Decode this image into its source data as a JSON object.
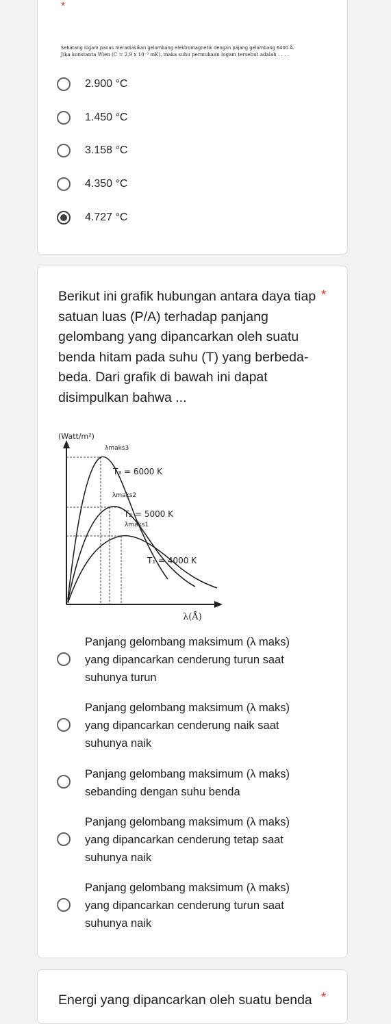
{
  "q1": {
    "required_mark": "*",
    "line1": "Sebatang logam panas meradiasikan gelombang elektromagnetik dengan pajang gelombang 6400 Å.",
    "line2": "Jika konstanta Wien (C = 2,9 x 10⁻³ mK), maka suhu permukaan logam tersebut adalah . . . .",
    "options": [
      {
        "label": "2.900 °C",
        "selected": false
      },
      {
        "label": "1.450 °C",
        "selected": false
      },
      {
        "label": "3.158 °C",
        "selected": false
      },
      {
        "label": "4.350 °C",
        "selected": false
      },
      {
        "label": "4.727 °C",
        "selected": true
      }
    ]
  },
  "q2": {
    "required_mark": "*",
    "title": "Berikut ini grafik hubungan antara daya tiap satuan luas (P/A) terhadap panjang gelombang yang dipancarkan oleh suatu benda hitam pada suhu (T) yang berbeda-beda. Dari grafik di bawah ini dapat disimpulkan bahwa ...",
    "graph": {
      "y_label": "(Watt/m²)",
      "x_label": "λ(Å)",
      "peak_labels": [
        "λmaks3",
        "λmaks2",
        "λmaks1"
      ],
      "curve_labels": [
        "T₃ = 6000 K",
        "T₂ = 5000 K",
        "T₁ = 4000 K"
      ]
    },
    "options": [
      {
        "lines": [
          "Panjang gelombang maksimum (λ maks)",
          "yang dipancarkan cenderung turun saat",
          "suhunya turun"
        ]
      },
      {
        "lines": [
          "Panjang gelombang maksimum (λ maks)",
          "yang dipancarkan cenderung naik saat",
          "suhunya naik"
        ]
      },
      {
        "lines": [
          "Panjang gelombang maksimum (λ maks)",
          "sebanding dengan suhu benda"
        ]
      },
      {
        "lines": [
          "Panjang gelombang maksimum (λ maks)",
          "yang dipancarkan cenderung tetap saat",
          "suhunya naik"
        ]
      },
      {
        "lines": [
          "Panjang gelombang maksimum (λ maks)",
          "yang dipancarkan cenderung turun saat",
          "suhunya naik"
        ]
      }
    ]
  },
  "q3": {
    "required_mark": "*",
    "title": "Energi yang dipancarkan oleh suatu benda"
  },
  "colors": {
    "background": "#f1f3f4",
    "card": "#ffffff",
    "required": "#d93025",
    "radio": "#5f6368"
  }
}
